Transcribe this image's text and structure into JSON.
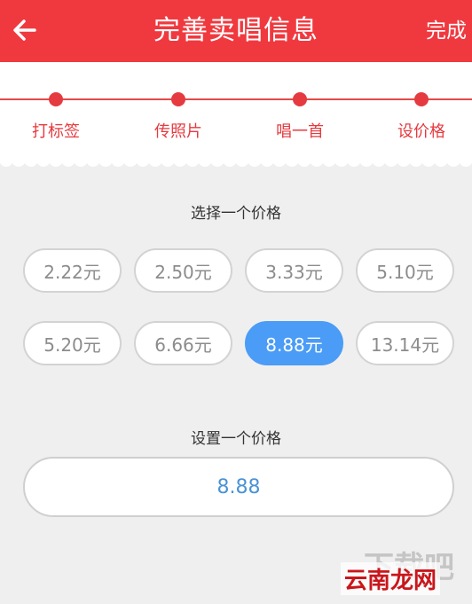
{
  "header": {
    "title": "完善卖唱信息",
    "done_label": "完成",
    "back_icon": "arrow-left-icon",
    "bg_color": "#f0393f"
  },
  "steps": [
    {
      "label": "打标签"
    },
    {
      "label": "传照片"
    },
    {
      "label": "唱一首"
    },
    {
      "label": "设价格"
    }
  ],
  "select_price": {
    "title": "选择一个价格",
    "options": [
      {
        "label": "2.22元",
        "selected": false
      },
      {
        "label": "2.50元",
        "selected": false
      },
      {
        "label": "3.33元",
        "selected": false
      },
      {
        "label": "5.10元",
        "selected": false
      },
      {
        "label": "5.20元",
        "selected": false
      },
      {
        "label": "6.66元",
        "selected": false
      },
      {
        "label": "8.88元",
        "selected": true
      },
      {
        "label": "13.14元",
        "selected": false
      }
    ],
    "selected_color": "#4a9cf6"
  },
  "custom_price": {
    "title": "设置一个价格",
    "value": "8.88"
  },
  "watermark": {
    "text": "下载吧",
    "badge": "云南龙网"
  }
}
